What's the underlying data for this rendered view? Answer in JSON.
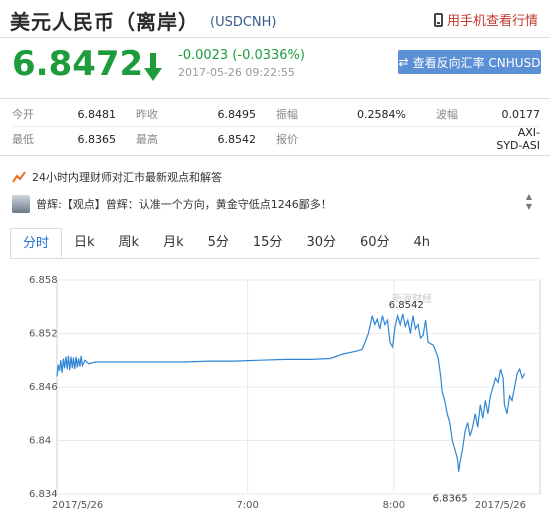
{
  "header": {
    "title": "美元人民币（离岸）",
    "code": "(USDCNH)",
    "mobile_link": "用手机查看行情"
  },
  "quote": {
    "price": "6.8472",
    "direction": "down",
    "change": "-0.0023 (-0.0336%)",
    "time": "2017-05-26 09:22:55",
    "reverse_button": "查看反向汇率 CNHUSD",
    "price_color": "#1e9c3c"
  },
  "stats": {
    "row1": [
      {
        "label": "今开",
        "value": "6.8481"
      },
      {
        "label": "昨收",
        "value": "6.8495"
      },
      {
        "label": "振幅",
        "value": "0.2584%"
      },
      {
        "label": "波幅",
        "value": "0.0177"
      }
    ],
    "row2": [
      {
        "label": "最低",
        "value": "6.8365"
      },
      {
        "label": "最高",
        "value": "6.8542"
      },
      {
        "label": "报价",
        "value": ""
      },
      {
        "label": "",
        "value": "AXI-SYD-ASI"
      }
    ]
  },
  "news": {
    "headline": "24小时内理财师对汇市最新观点和解答",
    "item": "曾辉:【观点】曾辉：认准一个方向，黄金守低点1246鄙多！"
  },
  "tabs": [
    "分时",
    "日k",
    "周k",
    "月k",
    "5分",
    "15分",
    "30分",
    "60分",
    "4h"
  ],
  "chart_data": {
    "type": "line",
    "yticks": [
      "6.858",
      "6.852",
      "6.846",
      "6.84",
      "6.834"
    ],
    "ylim": [
      6.834,
      6.858
    ],
    "xticks": [
      "2017/5/26",
      "7:00",
      "8:00",
      "2017/5/26"
    ],
    "high_label": "6.8542",
    "low_label": "6.8365",
    "watermark": "新浪财经",
    "line_color": "#2f86d6",
    "series": [
      {
        "name": "",
        "points": [
          [
            0,
            6.8472
          ],
          [
            1,
            6.8485
          ],
          [
            2,
            6.8478
          ],
          [
            3,
            6.849
          ],
          [
            4,
            6.8476
          ],
          [
            5,
            6.8492
          ],
          [
            6,
            6.8481
          ],
          [
            7,
            6.8494
          ],
          [
            8,
            6.848
          ],
          [
            9,
            6.8495
          ],
          [
            10,
            6.8479
          ],
          [
            11,
            6.8494
          ],
          [
            12,
            6.8481
          ],
          [
            13,
            6.8493
          ],
          [
            14,
            6.848
          ],
          [
            15,
            6.8494
          ],
          [
            16,
            6.8482
          ],
          [
            17,
            6.8492
          ],
          [
            18,
            6.8483
          ],
          [
            19,
            6.8495
          ],
          [
            20,
            6.8484
          ],
          [
            22,
            6.849
          ],
          [
            25,
            6.8486
          ],
          [
            30,
            6.8488
          ],
          [
            40,
            6.8488
          ],
          [
            60,
            6.8488
          ],
          [
            80,
            6.8488
          ],
          [
            100,
            6.8488
          ],
          [
            120,
            6.8489
          ],
          [
            140,
            6.8489
          ],
          [
            160,
            6.849
          ],
          [
            180,
            6.8491
          ],
          [
            200,
            6.8491
          ],
          [
            215,
            6.8492
          ],
          [
            225,
            6.8497
          ],
          [
            235,
            6.85
          ],
          [
            240,
            6.8502
          ],
          [
            245,
            6.852
          ],
          [
            248,
            6.854
          ],
          [
            250,
            6.853
          ],
          [
            252,
            6.8536
          ],
          [
            254,
            6.8525
          ],
          [
            256,
            6.854
          ],
          [
            258,
            6.853
          ],
          [
            260,
            6.8535
          ],
          [
            262,
            6.851
          ],
          [
            264,
            6.8505
          ],
          [
            266,
            6.8528
          ],
          [
            268,
            6.854
          ],
          [
            270,
            6.853
          ],
          [
            272,
            6.8542
          ],
          [
            274,
            6.8528
          ],
          [
            276,
            6.8535
          ],
          [
            278,
            6.852
          ],
          [
            280,
            6.854
          ],
          [
            282,
            6.8525
          ],
          [
            284,
            6.853
          ],
          [
            286,
            6.8515
          ],
          [
            288,
            6.8518
          ],
          [
            290,
            6.8535
          ],
          [
            292,
            6.851
          ],
          [
            296,
            6.8507
          ],
          [
            298,
            6.85
          ],
          [
            300,
            6.8492
          ],
          [
            302,
            6.847
          ],
          [
            303,
            6.8455
          ],
          [
            305,
            6.8445
          ],
          [
            307,
            6.843
          ],
          [
            309,
            6.842
          ],
          [
            311,
            6.84
          ],
          [
            313,
            6.839
          ],
          [
            315,
            6.838
          ],
          [
            316,
            6.8365
          ],
          [
            317,
            6.8375
          ],
          [
            319,
            6.839
          ],
          [
            321,
            6.841
          ],
          [
            323,
            6.842
          ],
          [
            325,
            6.8405
          ],
          [
            327,
            6.8415
          ],
          [
            329,
            6.843
          ],
          [
            331,
            6.8415
          ],
          [
            333,
            6.844
          ],
          [
            335,
            6.8425
          ],
          [
            337,
            6.8445
          ],
          [
            339,
            6.843
          ],
          [
            341,
            6.845
          ],
          [
            343,
            6.846
          ],
          [
            345,
            6.847
          ],
          [
            347,
            6.8465
          ],
          [
            349,
            6.848
          ],
          [
            351,
            6.847
          ],
          [
            352,
            6.844
          ],
          [
            354,
            6.843
          ],
          [
            356,
            6.845
          ],
          [
            358,
            6.8445
          ],
          [
            360,
            6.846
          ],
          [
            362,
            6.8475
          ],
          [
            364,
            6.848
          ],
          [
            366,
            6.847
          ],
          [
            368,
            6.8475
          ]
        ]
      }
    ]
  }
}
